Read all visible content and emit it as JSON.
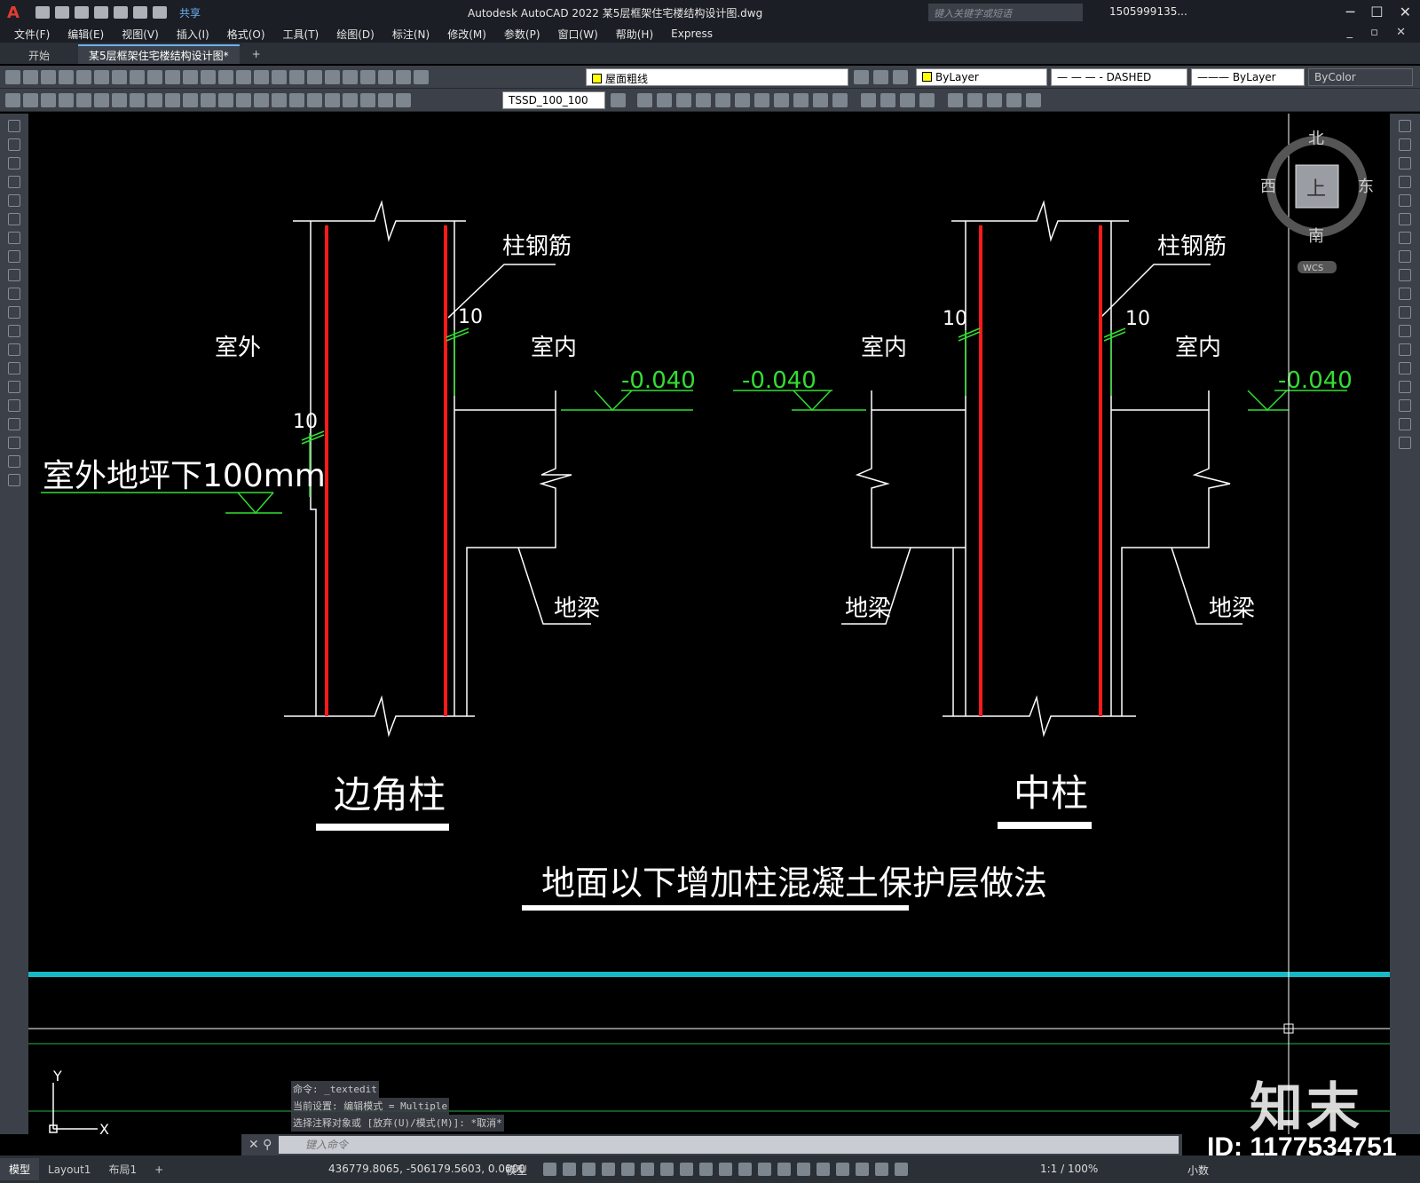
{
  "app": {
    "title": "Autodesk AutoCAD 2022    某5层框架住宅楼结构设计图.dwg",
    "share_label": "共享",
    "search_placeholder": "键入关键字或短语",
    "user_label": "1505999135...",
    "logo_letter": "A"
  },
  "menu": [
    "文件(F)",
    "编辑(E)",
    "视图(V)",
    "插入(I)",
    "格式(O)",
    "工具(T)",
    "绘图(D)",
    "标注(N)",
    "修改(M)",
    "参数(P)",
    "窗口(W)",
    "帮助(H)",
    "Express"
  ],
  "tabs": [
    {
      "label": "开始",
      "active": false
    },
    {
      "label": "某5层框架住宅楼结构设计图*",
      "active": true
    }
  ],
  "toolbar": {
    "layer": "屋面粗线",
    "color": "ByLayer",
    "linetype": "— — — - DASHED",
    "lineweight": "——— ByLayer",
    "plotstyle": "ByColor",
    "dimstyle": "TSSD_100_100"
  },
  "viewcube": {
    "north": "北",
    "south": "南",
    "east": "东",
    "west": "西",
    "top": "上",
    "wcs": "WCS"
  },
  "drawing": {
    "left": {
      "outside": "室外",
      "inside": "室内",
      "rebar": "柱钢筋",
      "dim_top": "10",
      "dim_left": "10",
      "elevation": "-0.040",
      "ground_note": "室外地坪下100mm",
      "beam": "地梁",
      "title": "边角柱"
    },
    "right": {
      "inside_left": "室内",
      "inside_right": "室内",
      "rebar": "柱钢筋",
      "dim_left": "10",
      "dim_right": "10",
      "elevation_left": "-0.040",
      "elevation_right": "-0.040",
      "beam_left": "地梁",
      "beam_right": "地梁",
      "title": "中柱"
    },
    "main_title": "地面以下增加柱混凝土保护层做法",
    "ucs_x": "X",
    "ucs_y": "Y"
  },
  "command": {
    "history": [
      "命令: _textedit",
      "当前设置: 编辑模式 = Multiple",
      "选择注释对象或 [放弃(U)/模式(M)]: *取消*"
    ],
    "placeholder": "键入命令"
  },
  "status": {
    "tabs": [
      {
        "label": "模型",
        "active": true
      },
      {
        "label": "Layout1",
        "active": false
      },
      {
        "label": "布局1",
        "active": false
      }
    ],
    "coords": "436779.8065, -506179.5603, 0.0000",
    "model": "模型",
    "scale": "1:1 / 100%",
    "units": "小数"
  },
  "watermark": {
    "brand": "知末",
    "id": "ID: 1177534751"
  },
  "colors": {
    "rebar": "#ff1a1a",
    "dim": "#33dd33",
    "line": "#ffffff",
    "cyan": "#17b9c4",
    "ui_dark": "#3b4049"
  }
}
